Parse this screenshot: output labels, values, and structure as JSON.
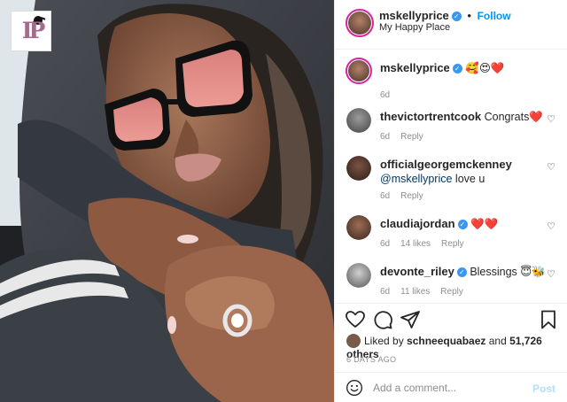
{
  "post": {
    "logo_letters": "IP",
    "author": "mskellyprice",
    "follow_label": "Follow",
    "location": "My Happy Place",
    "separator": "•"
  },
  "caption": {
    "username": "mskellyprice",
    "emojis": "🥰😍❤️",
    "age": "6d"
  },
  "comments": [
    {
      "username": "thevictortrentcook",
      "text": "Congrats❤️",
      "age": "6d",
      "likes": "",
      "reply": "Reply",
      "verified": false
    },
    {
      "username": "officialgeorgemckenney",
      "mention": "@mskellyprice",
      "text": " love u",
      "age": "6d",
      "likes": "",
      "reply": "Reply",
      "verified": false
    },
    {
      "username": "claudiajordan",
      "text": "❤️❤️",
      "age": "6d",
      "likes": "14 likes",
      "reply": "Reply",
      "verified": true
    },
    {
      "username": "devonte_riley",
      "text": "Blessings 😇🐝",
      "age": "6d",
      "likes": "11 likes",
      "reply": "Reply",
      "verified": true
    }
  ],
  "likes_bar": {
    "prefix": "Liked by ",
    "first_liker": "schneequabaez",
    "middle": " and ",
    "others": "51,726 others",
    "timestamp": "6 DAYS AGO"
  },
  "comment_box": {
    "placeholder": "Add a comment...",
    "post_label": "Post"
  },
  "icons": {
    "like": "heart-icon",
    "comment": "comment-icon",
    "share": "share-icon",
    "save": "bookmark-icon",
    "emoji": "smile-icon",
    "verified": "verified-badge-icon"
  },
  "colors": {
    "link_blue": "#0095f6",
    "verified_blue": "#3897f0",
    "muted": "#8e8e8e",
    "text": "#262626"
  }
}
